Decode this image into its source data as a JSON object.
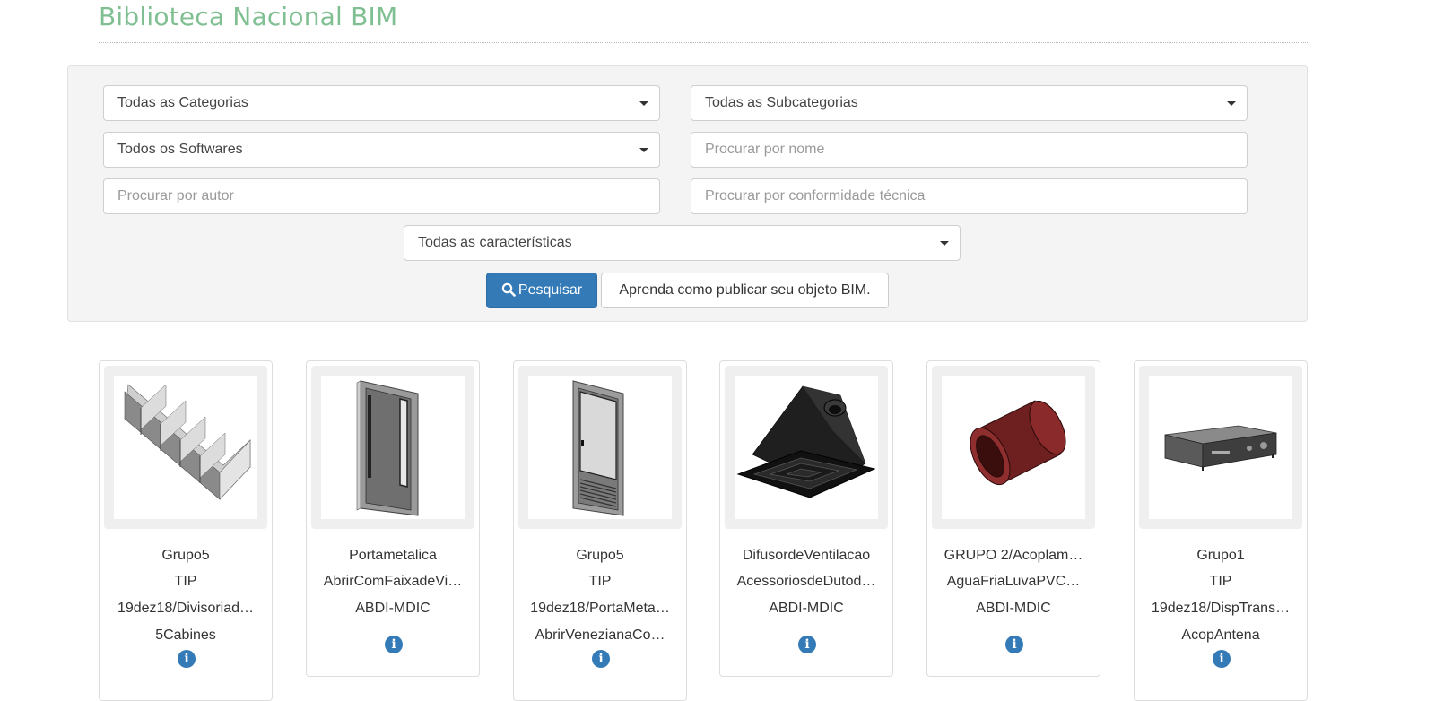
{
  "page": {
    "title": "Biblioteca Nacional BIM"
  },
  "filters": {
    "categories": "Todas as Categorias",
    "subcategories": "Todas as Subcategorias",
    "softwares": "Todos os Softwares",
    "name_placeholder": "Procurar por nome",
    "author_placeholder": "Procurar por autor",
    "conformity_placeholder": "Procurar por conformidade técnica",
    "characteristics": "Todas as características",
    "search_label": "Pesquisar",
    "publish_label": "Aprenda como publicar seu objeto BIM."
  },
  "colors": {
    "title": "#7fbf91",
    "primary": "#337ab7"
  },
  "cards": [
    {
      "icon": "cubicles-icon",
      "l1": "Grupo5",
      "l2": "TIP",
      "l3": "19dez18/Divisoriad…",
      "l4": "5Cabines"
    },
    {
      "icon": "metal-door-icon",
      "l1": "Portametalica",
      "l2": "AbrirComFaixadeVi…",
      "l3": "ABDI-MDIC",
      "l4": ""
    },
    {
      "icon": "glass-door-icon",
      "l1": "Grupo5",
      "l2": "TIP",
      "l3": "19dez18/PortaMeta…",
      "l4": "AbrirVenezianaCo…"
    },
    {
      "icon": "ventilation-diffuser-icon",
      "l1": "DifusordeVentilacao",
      "l2": "AcessoriosdeDutod…",
      "l3": "ABDI-MDIC",
      "l4": ""
    },
    {
      "icon": "pvc-coupling-icon",
      "l1": "GRUPO 2/Acoplam…",
      "l2": "AguaFriaLuvaPVC…",
      "l3": "ABDI-MDIC",
      "l4": ""
    },
    {
      "icon": "amplifier-icon",
      "l1": "Grupo1",
      "l2": "TIP",
      "l3": "19dez18/DispTrans…",
      "l4": "AcopAntena"
    }
  ]
}
